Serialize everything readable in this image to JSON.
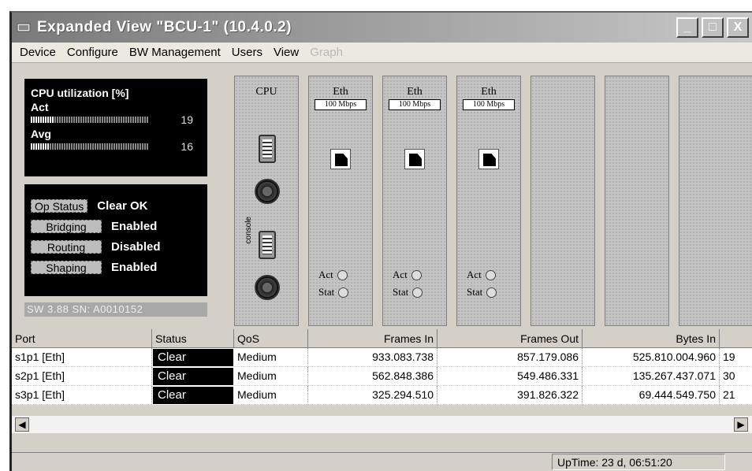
{
  "window": {
    "title": "Expanded View \"BCU-1\" (10.4.0.2)",
    "controls": {
      "minimize": "_",
      "maximize": "□",
      "close": "X"
    }
  },
  "menu": {
    "items": [
      {
        "label": "Device",
        "enabled": true
      },
      {
        "label": "Configure",
        "enabled": true
      },
      {
        "label": "BW Management",
        "enabled": true
      },
      {
        "label": "Users",
        "enabled": true
      },
      {
        "label": "View",
        "enabled": true
      },
      {
        "label": "Graph",
        "enabled": false
      }
    ]
  },
  "cpu": {
    "title": "CPU utilization [%]",
    "act": {
      "label": "Act",
      "value": "19",
      "fraction": 0.19
    },
    "avg": {
      "label": "Avg",
      "value": "16",
      "fraction": 0.16
    }
  },
  "status": {
    "op_status": {
      "key": "Op Status",
      "value": "Clear OK"
    },
    "bridging": {
      "key": "Bridging",
      "value": "Enabled"
    },
    "routing": {
      "key": "Routing",
      "value": "Disabled"
    },
    "shaping": {
      "key": "Shaping",
      "value": "Enabled"
    }
  },
  "sw_strip": "SW 3.88  SN: A0010152",
  "slots": {
    "cpu": {
      "title": "CPU",
      "console_label": "console"
    },
    "eth": [
      {
        "title": "Eth",
        "speed": "100 Mbps",
        "act": "Act",
        "stat": "Stat"
      },
      {
        "title": "Eth",
        "speed": "100 Mbps",
        "act": "Act",
        "stat": "Stat"
      },
      {
        "title": "Eth",
        "speed": "100 Mbps",
        "act": "Act",
        "stat": "Stat"
      }
    ]
  },
  "table": {
    "headers": [
      "Port",
      "Status",
      "QoS",
      "Frames In",
      "Frames Out",
      "Bytes In",
      ""
    ],
    "rows": [
      [
        "s1p1  [Eth]",
        "Clear",
        "Medium",
        "933.083.738",
        "857.179.086",
        "525.810.004.960",
        "19"
      ],
      [
        "s2p1  [Eth]",
        "Clear",
        "Medium",
        "562.848.386",
        "549.486.331",
        "135.267.437.071",
        "30"
      ],
      [
        "s3p1  [Eth]",
        "Clear",
        "Medium",
        "325.294.510",
        "391.826.322",
        "69.444.549.750",
        "21"
      ]
    ]
  },
  "statusbar": {
    "uptime": "UpTime:  23 d, 06:51:20"
  }
}
